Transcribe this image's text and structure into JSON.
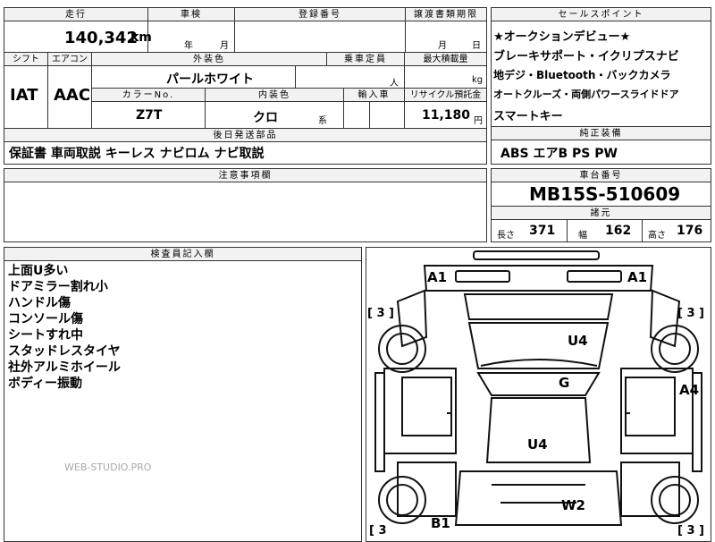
{
  "top_row": {
    "mileage_label": "走行",
    "inspection_label": "車検",
    "registration_label": "登録番号",
    "transfer_label": "譲渡書類期限",
    "sales_label": "セールスポイント"
  },
  "mileage": {
    "value": "140,342",
    "unit": "km"
  },
  "inspection": {
    "year": "年",
    "month": "月"
  },
  "transfer": {
    "month": "月",
    "day": "日"
  },
  "row2": {
    "shift_label": "シフト",
    "ac_label": "エアコン",
    "exterior_label": "外装色",
    "capacity_label": "乗車定員",
    "maxload_label": "最大積載量"
  },
  "shift": "IAT",
  "aircon": "AAC",
  "exterior_color": "パールホワイト",
  "capacity_unit": "人",
  "load_unit": "kg",
  "row3": {
    "color_no_label": "カラーNo.",
    "interior_label": "内装色",
    "import_label": "輸入車",
    "recycle_label": "リサイクル預託金"
  },
  "color_no": "Z7T",
  "interior": {
    "value": "クロ",
    "suffix": "系"
  },
  "recycle": {
    "value": "11,180",
    "unit": "円"
  },
  "sales_points": [
    "★オークションデビュー★",
    "ブレーキサポート・イクリプスナビ",
    "地デジ・Bluetooth・バックカメラ",
    "オートクルーズ・両側パワースライドドア",
    "スマートキー"
  ],
  "later_parts": {
    "label": "後日発送部品",
    "value": "保証書 車両取説 キーレス ナビロム ナビ取説"
  },
  "equipment": {
    "label": "純正装備",
    "value": "ABS エアB PS PW"
  },
  "notes_label": "注意事項欄",
  "chassis": {
    "label": "車台番号",
    "value": "MB15S-510609"
  },
  "dims": {
    "label": "諸元",
    "length_label": "長さ",
    "length": "371",
    "width_label": "幅",
    "width": "162",
    "height_label": "高さ",
    "height": "176"
  },
  "inspector": {
    "label": "検査員記入欄",
    "items": [
      "上面U多い",
      "ドアミラー割れ小",
      "ハンドル傷",
      "コンソール傷",
      "シートすれ中",
      "スタッドレスタイヤ",
      "社外アルミホイール",
      "ボディー振動"
    ]
  },
  "watermark": "WEB-STUDIO.PRO",
  "diagram": {
    "tl": "A1",
    "tr": "A1",
    "u4_top": "U4",
    "g": "G",
    "a4": "A4",
    "u4_mid": "U4",
    "w2": "W2",
    "b1": "B1",
    "b3_tl": "[ 3 ]",
    "b3_tr": "[ 3 ]",
    "b3_bl": "[ 3",
    "b3_br": "[ 3 ]"
  }
}
